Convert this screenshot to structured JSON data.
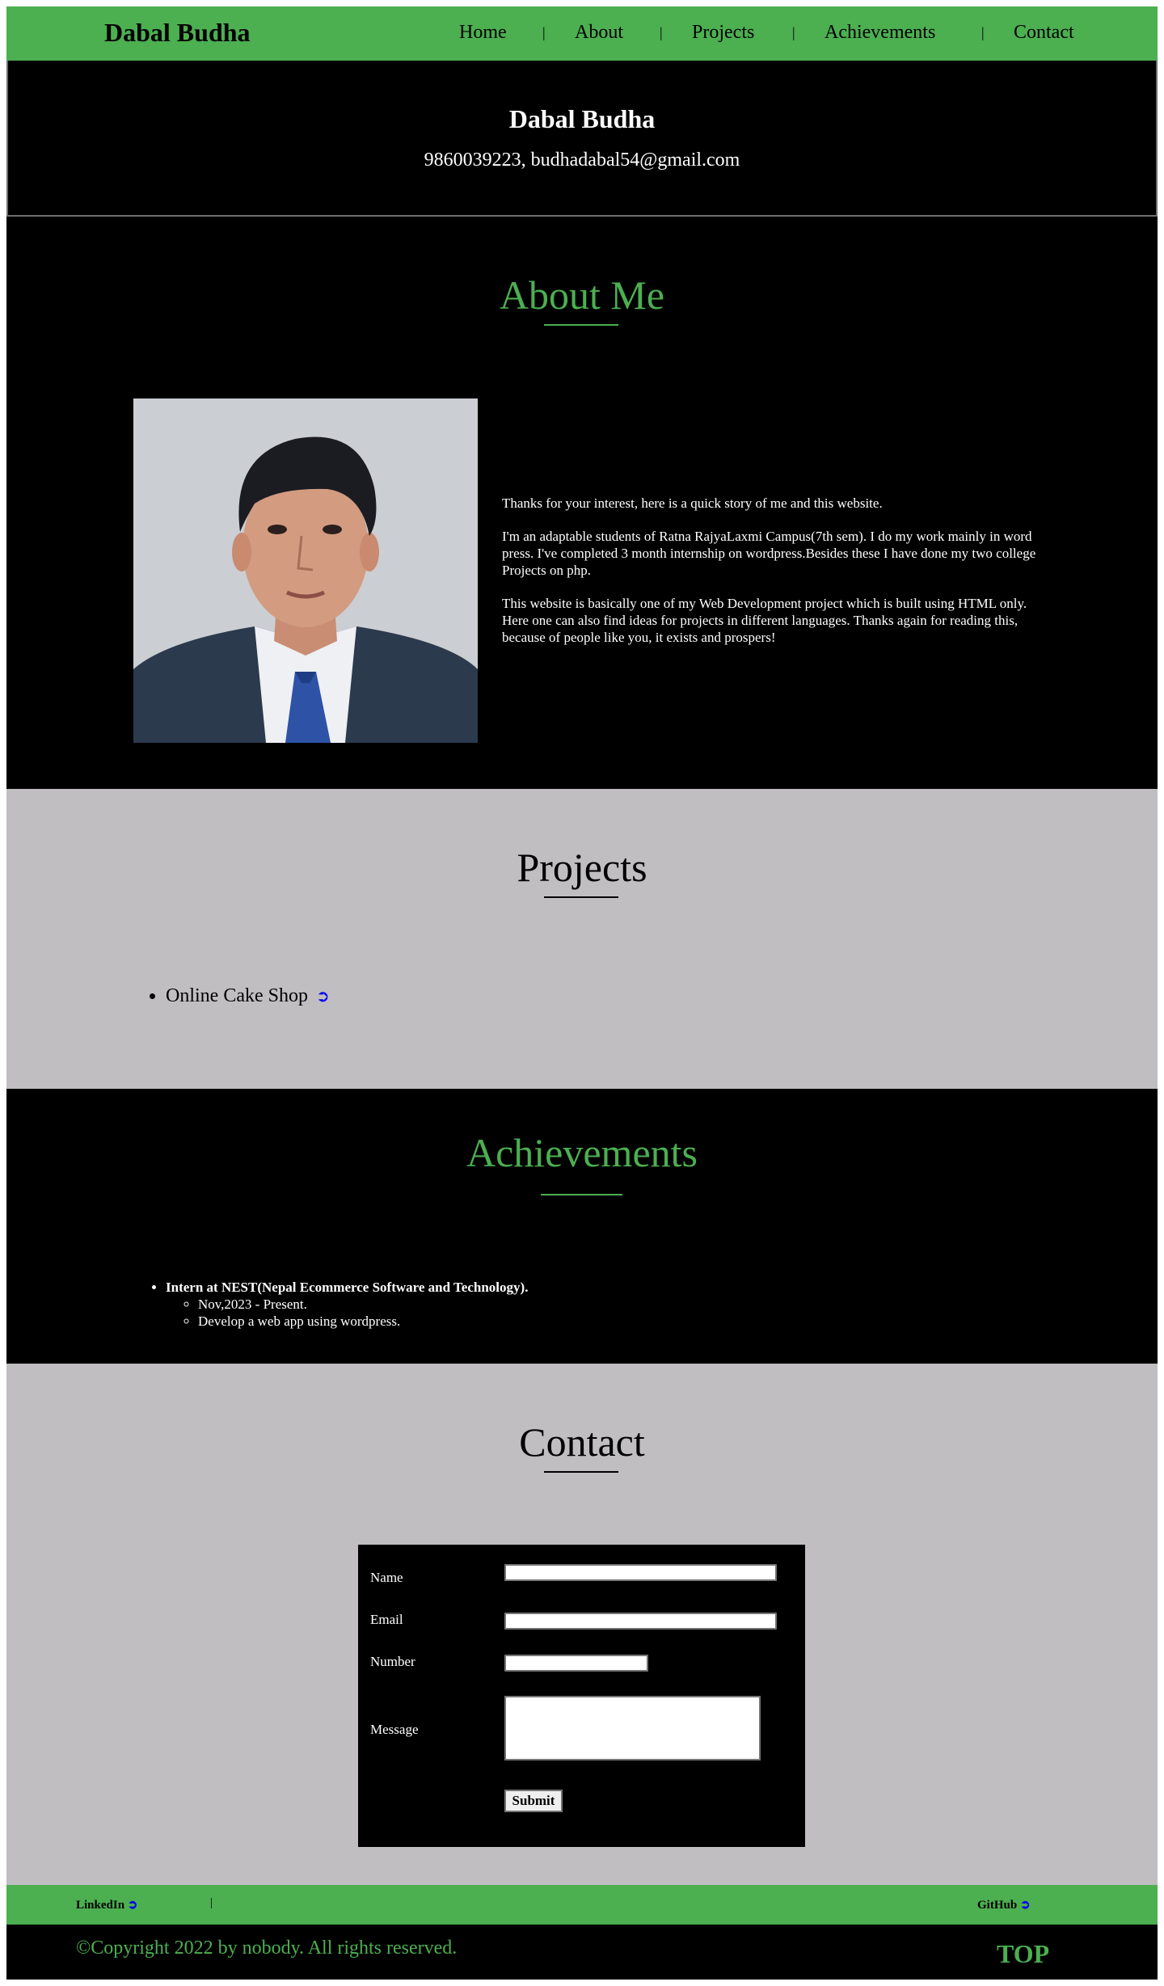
{
  "nav": {
    "brand": "Dabal Budha",
    "links": [
      "Home",
      "About",
      "Projects",
      "Achievements",
      "Contact"
    ],
    "separator": "|"
  },
  "header": {
    "name": "Dabal Budha",
    "contact": "9860039223, budhadabal54@gmail.com"
  },
  "about": {
    "title": "About Me",
    "paragraphs": [
      "Thanks for your interest, here is a quick story of me and this website.",
      "I'm an adaptable students of Ratna RajyaLaxmi Campus(7th sem). I do my work mainly in word press. I've completed 3 month internship on wordpress.Besides these I have done my two college Projects on php.",
      "This website is basically one of my Web Development project which is built using HTML only. Here one can also find ideas for projects in different languages. Thanks again for reading this, because of people like you, it exists and prospers!"
    ]
  },
  "projects": {
    "title": "Projects",
    "items": [
      {
        "label": "Online Cake Shop",
        "link_glyph": "➲"
      }
    ]
  },
  "achievements": {
    "title": "Achievements",
    "items": [
      {
        "label": "Intern at NEST(Nepal Ecommerce Software and Technology).",
        "details": [
          "Nov,2023 - Present.",
          "Develop a web app using wordpress."
        ]
      }
    ]
  },
  "contact": {
    "title": "Contact",
    "form": {
      "name_label": "Name",
      "email_label": "Email",
      "number_label": "Number",
      "message_label": "Message",
      "name_value": "",
      "email_value": "",
      "number_value": "",
      "message_value": "",
      "submit_label": "Submit"
    }
  },
  "footer": {
    "linkedin": "LinkedIn",
    "github": "GitHub",
    "link_glyph": "➲",
    "separator": "|",
    "copyright": "©Copyright 2022 by nobody. All rights reserved.",
    "top": "TOP"
  },
  "colors": {
    "accent": "#4caf50",
    "dark": "#000000",
    "light_section": "#c0bec1"
  }
}
